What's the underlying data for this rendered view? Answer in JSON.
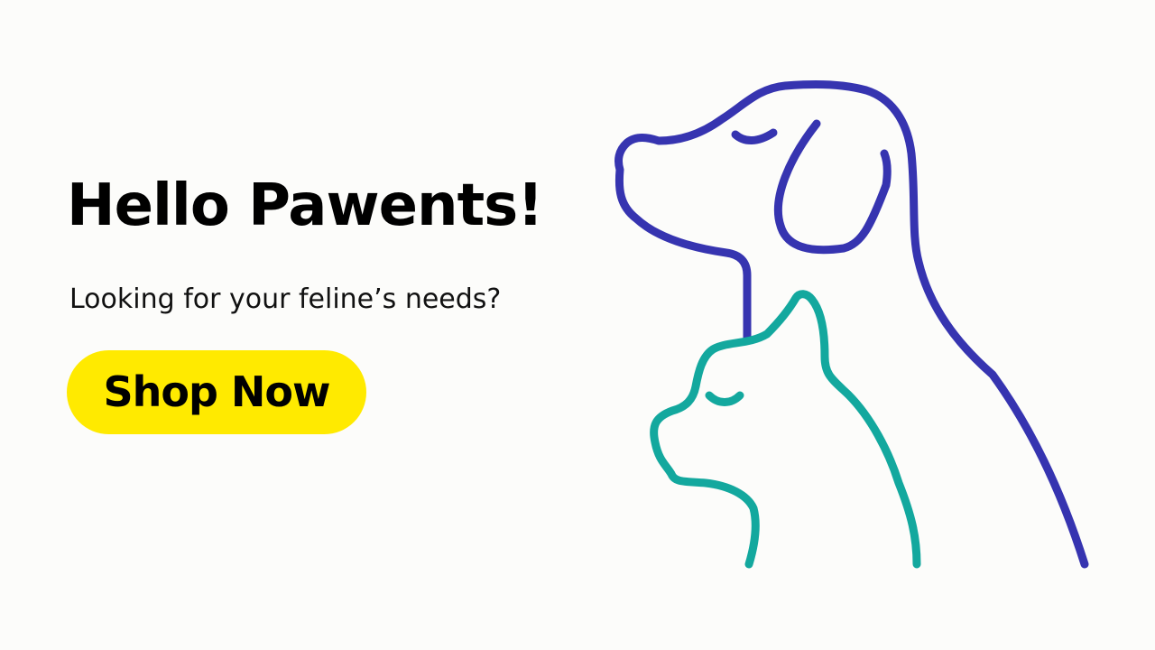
{
  "hero": {
    "headline": "Hello Pawents!",
    "subline": "Looking for your feline’s needs?",
    "cta_label": "Shop Now"
  },
  "illustration": {
    "dog_icon": "dog-outline-icon",
    "cat_icon": "cat-outline-icon"
  },
  "colors": {
    "background": "#FCFCFA",
    "text": "#000000",
    "button": "#FFEA00",
    "dog_line": "#3634B0",
    "cat_line": "#13A89E"
  }
}
